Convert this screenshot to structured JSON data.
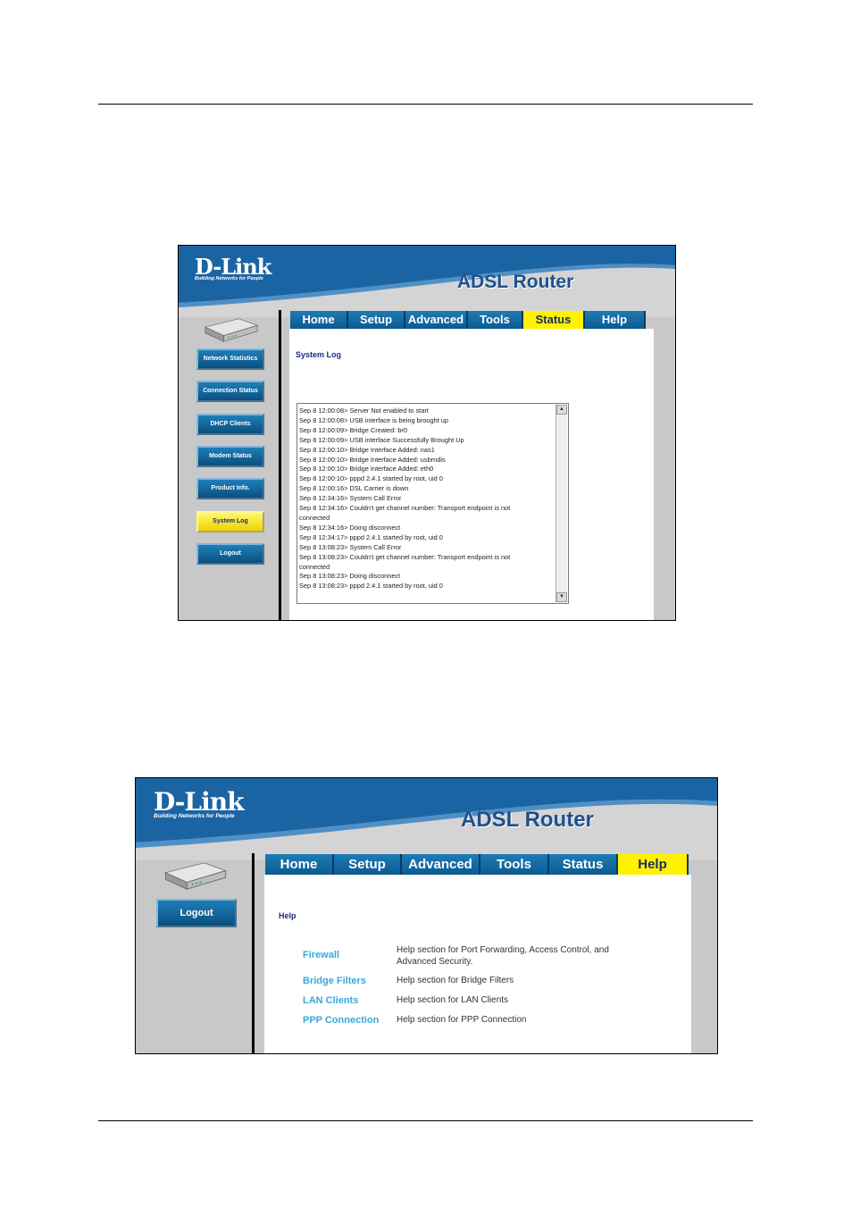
{
  "brand": {
    "logo": "D-Link",
    "tagline": "Building Networks for People",
    "product": "ADSL Router"
  },
  "tabs": [
    "Home",
    "Setup",
    "Advanced",
    "Tools",
    "Status",
    "Help"
  ],
  "screens": {
    "status": {
      "active_tab": "Status",
      "sidebar": [
        "Network Statistics",
        "Connection Status",
        "DHCP Clients",
        "Modem Status",
        "Product Info.",
        "System Log",
        "Logout"
      ],
      "active_sidebar": "System Log",
      "section_title": "System Log",
      "log": [
        "Sep  8 12:00:08> Server Not enabled to start",
        "Sep  8 12:00:08> USB interface is being brought up",
        "Sep  8 12:00:09> Bridge Created: br0",
        "Sep  8 12:00:09> USB interface Successfully Brought Up",
        "Sep  8 12:00:10> Bridge Interface Added: nas1",
        "Sep  8 12:00:10> Bridge Interface Added: usbrndis",
        "Sep  8 12:00:10> Bridge Interface Added: eth0",
        "Sep  8 12:00:10> pppd 2.4.1 started by root, uid 0",
        "Sep  8 12:00:16> DSL Carrier is down",
        "Sep  8 12:34:16> System Call Error",
        "Sep  8 12:34:16> Couldn't get channel number: Transport endpoint is not",
        "connected",
        "Sep  8 12:34:16> Doing disconnect",
        "Sep  8 12:34:17> pppd 2.4.1 started by root, uid 0",
        "Sep  8 13:08:23> System Call Error",
        "Sep  8 13:08:23> Couldn't get channel number: Transport endpoint is not",
        "connected",
        "Sep  8 13:08:23> Doing disconnect",
        "Sep  8 13:08:23> pppd 2.4.1 started by root, uid 0"
      ]
    },
    "help": {
      "active_tab": "Help",
      "sidebar": [
        "Logout"
      ],
      "section_title": "Help",
      "links": [
        {
          "label": "Firewall",
          "desc": "Help section for Port Forwarding, Access Control, and Advanced Security."
        },
        {
          "label": "Bridge Filters",
          "desc": "Help section for Bridge Filters"
        },
        {
          "label": "LAN Clients",
          "desc": "Help section for LAN Clients"
        },
        {
          "label": "PPP Connection",
          "desc": "Help section for PPP Connection"
        }
      ]
    }
  },
  "colors": {
    "banner_blue": "#1b64a4",
    "tab_blue": "#1e7cb5",
    "active_yellow": "#fff200",
    "link_cyan": "#38a8d8",
    "title_navy": "#1c2a8a"
  }
}
